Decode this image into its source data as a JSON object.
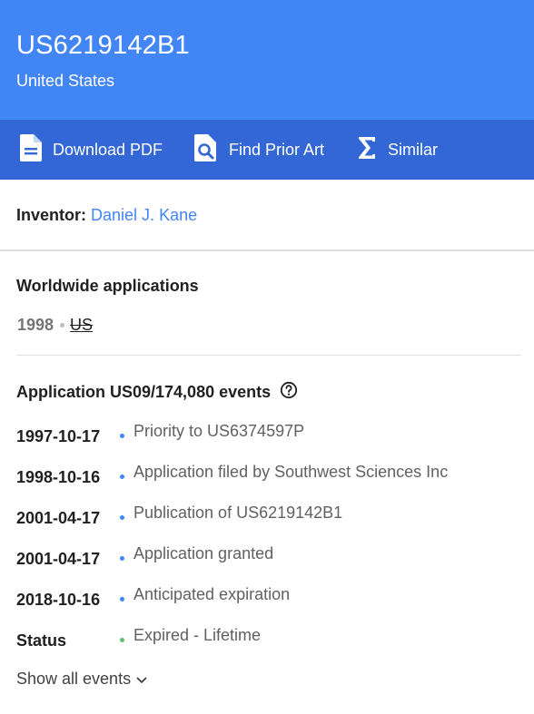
{
  "header": {
    "publication_number": "US6219142B1",
    "country": "United States",
    "background_color": "#4285f4"
  },
  "toolbar": {
    "background_color": "#3367d6",
    "download_pdf": {
      "label": "Download PDF",
      "icon": "pdf-file-icon"
    },
    "find_prior_art": {
      "label": "Find Prior Art",
      "icon": "search-document-icon"
    },
    "similar": {
      "label": "Similar",
      "icon": "sigma-icon"
    }
  },
  "inventor": {
    "label": "Inventor:",
    "name": "Daniel J. Kane"
  },
  "worldwide": {
    "title": "Worldwide applications",
    "year": "1998",
    "country": "US"
  },
  "events": {
    "title": "Application US09/174,080 events",
    "items": [
      {
        "date": "1997-10-17",
        "description": "Priority to US6374597P",
        "bullet_color": "#4285f4"
      },
      {
        "date": "1998-10-16",
        "description": "Application filed by Southwest Sciences Inc",
        "bullet_color": "#4285f4"
      },
      {
        "date": "2001-04-17",
        "description": "Publication of US6219142B1",
        "bullet_color": "#4285f4"
      },
      {
        "date": "2001-04-17",
        "description": "Application granted",
        "bullet_color": "#4285f4"
      },
      {
        "date": "2018-10-16",
        "description": "Anticipated expiration",
        "bullet_color": "#4285f4"
      },
      {
        "date": "Status",
        "description": "Expired - Lifetime",
        "bullet_color": "#66bb6a"
      }
    ],
    "show_all_label": "Show all events"
  }
}
